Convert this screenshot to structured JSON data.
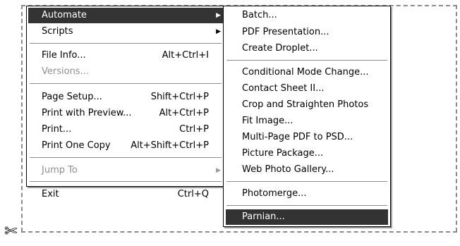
{
  "main_menu": {
    "items": [
      {
        "label": "Automate",
        "shortcut": "",
        "arrow": "▶"
      },
      {
        "label": "Scripts",
        "shortcut": "",
        "arrow": "▶"
      },
      {
        "label": "File Info...",
        "shortcut": "Alt+Ctrl+I"
      },
      {
        "label": "Versions...",
        "shortcut": ""
      },
      {
        "label": "Page Setup...",
        "shortcut": "Shift+Ctrl+P"
      },
      {
        "label": "Print with Preview...",
        "shortcut": "Alt+Ctrl+P"
      },
      {
        "label": "Print...",
        "shortcut": "Ctrl+P"
      },
      {
        "label": "Print One Copy",
        "shortcut": "Alt+Shift+Ctrl+P"
      },
      {
        "label": "Jump To",
        "shortcut": "",
        "arrow": "▶"
      },
      {
        "label": "Exit",
        "shortcut": "Ctrl+Q"
      }
    ]
  },
  "sub_menu": {
    "items": [
      {
        "label": "Batch..."
      },
      {
        "label": "PDF Presentation..."
      },
      {
        "label": "Create Droplet..."
      },
      {
        "label": "Conditional Mode Change..."
      },
      {
        "label": "Contact Sheet II..."
      },
      {
        "label": "Crop and Straighten Photos"
      },
      {
        "label": "Fit Image..."
      },
      {
        "label": "Multi-Page PDF to PSD..."
      },
      {
        "label": "Picture Package..."
      },
      {
        "label": "Web Photo Gallery..."
      },
      {
        "label": "Photomerge..."
      },
      {
        "label": "Parnian..."
      }
    ]
  },
  "colors": {
    "highlight": "#333333",
    "disabled_text": "#8f8f8f"
  }
}
